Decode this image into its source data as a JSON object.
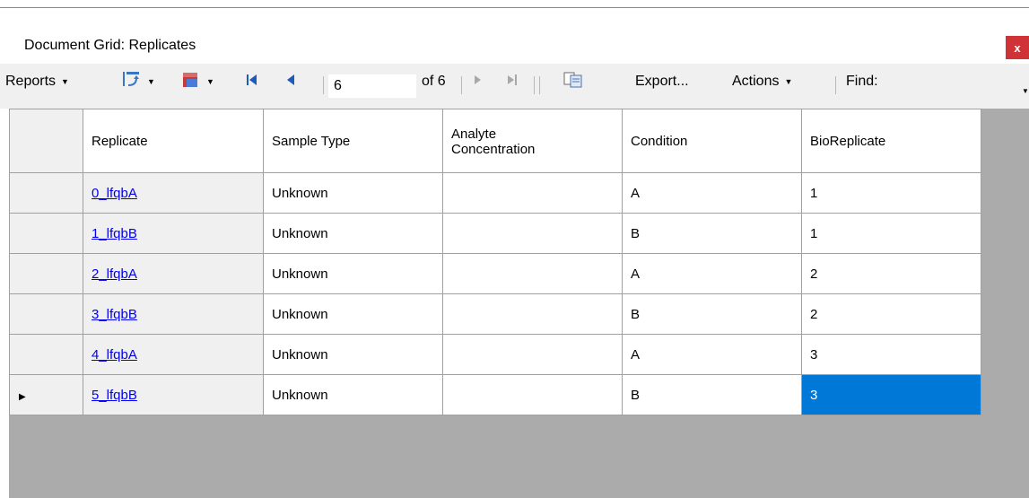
{
  "window": {
    "title": "Document Grid: Replicates",
    "close_label": "x"
  },
  "toolbar": {
    "reports_label": "Reports",
    "position_value": "6",
    "of_label": "of 6",
    "export_label": "Export...",
    "actions_label": "Actions",
    "find_label": "Find:"
  },
  "grid": {
    "headers": {
      "replicate": "Replicate",
      "sample_type": "Sample Type",
      "analyte_line1": "Analyte",
      "analyte_line2": "Concentration",
      "condition": "Condition",
      "bioreplicate": "BioReplicate"
    },
    "rows": [
      {
        "replicate": "0_lfqbA",
        "sample_type": "Unknown",
        "analyte": "",
        "condition": "A",
        "bioreplicate": "1"
      },
      {
        "replicate": "1_lfqbB",
        "sample_type": "Unknown",
        "analyte": "",
        "condition": "B",
        "bioreplicate": "1"
      },
      {
        "replicate": "2_lfqbA",
        "sample_type": "Unknown",
        "analyte": "",
        "condition": "A",
        "bioreplicate": "2"
      },
      {
        "replicate": "3_lfqbB",
        "sample_type": "Unknown",
        "analyte": "",
        "condition": "B",
        "bioreplicate": "2"
      },
      {
        "replicate": "4_lfqbA",
        "sample_type": "Unknown",
        "analyte": "",
        "condition": "A",
        "bioreplicate": "3"
      },
      {
        "replicate": "5_lfqbB",
        "sample_type": "Unknown",
        "analyte": "",
        "condition": "B",
        "bioreplicate": "3"
      }
    ],
    "current_row_indicator": "▶",
    "selection_color": "#0078d7",
    "link_color": "#0000ee"
  },
  "icons": [
    "caret-down-icon",
    "reports-view-icon",
    "layout-icon",
    "first-record-icon",
    "previous-record-icon",
    "next-record-icon",
    "last-record-icon",
    "copy-icon",
    "toolbar-overflow-icon"
  ]
}
